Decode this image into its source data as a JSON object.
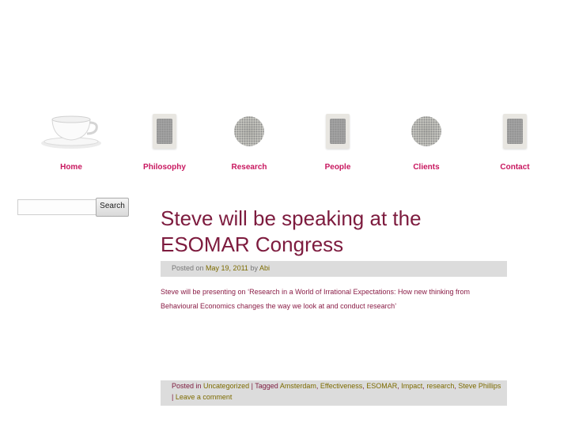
{
  "nav": {
    "items": [
      {
        "label": "Home",
        "icon": "teacup-icon"
      },
      {
        "label": "Philosophy",
        "icon": "teabag-icon"
      },
      {
        "label": "Research",
        "icon": "loose-tea-icon"
      },
      {
        "label": "People",
        "icon": "teabag-icon"
      },
      {
        "label": "Clients",
        "icon": "loose-tea-icon"
      },
      {
        "label": "Contact",
        "icon": "teabag-icon"
      }
    ]
  },
  "search": {
    "value": "",
    "placeholder": "",
    "button_label": "Search"
  },
  "post": {
    "title": "Steve will be speaking at the ESOMAR Congress",
    "meta": {
      "posted_on": "Posted on",
      "date": "May 19, 2011",
      "by": "by",
      "author": "Abi"
    },
    "content": "Steve will be presenting on ‘Research in a World of Irrational Expectations: How new thinking from Behavioural Economics changes the way we look at and conduct research’",
    "footer": {
      "posted_in": "Posted in",
      "category": "Uncategorized",
      "separator": "| Tagged",
      "tags": [
        "Amsterdam",
        "Effectiveness",
        "ESOMAR",
        "Impact",
        "research",
        "Steve Phillips"
      ],
      "comment_prefix": "|",
      "leave_comment": "Leave a comment"
    }
  },
  "colors": {
    "accent": "#c8175f",
    "title": "#7d1b3e",
    "link": "#7d6b00",
    "meta_bg": "#dcdcdc"
  }
}
